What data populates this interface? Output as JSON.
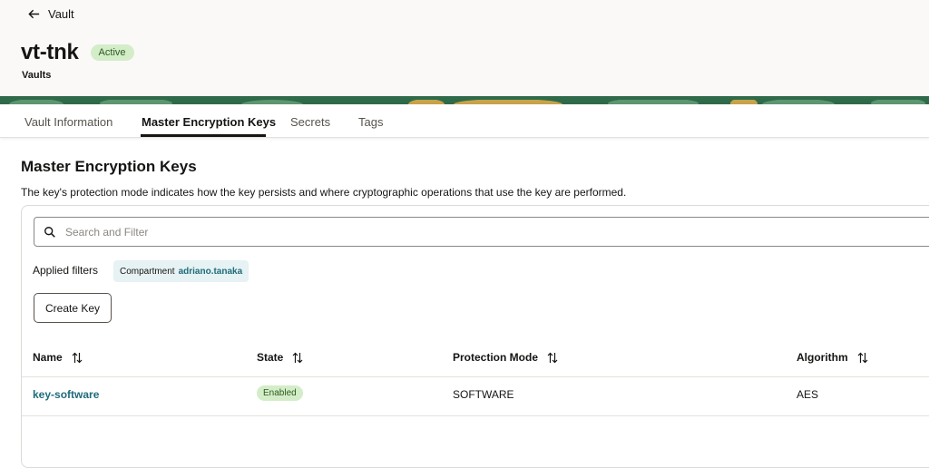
{
  "header": {
    "back_label": "Vault",
    "title": "vt-tnk",
    "status": "Active",
    "subtitle": "Vaults"
  },
  "tabs": [
    {
      "label": "Vault Information"
    },
    {
      "label": "Master Encryption Keys"
    },
    {
      "label": "Secrets"
    },
    {
      "label": "Tags"
    }
  ],
  "section": {
    "title": "Master Encryption Keys",
    "description": "The key's protection mode indicates how the key persists and where cryptographic operations that use the key are performed."
  },
  "search": {
    "placeholder": "Search and Filter",
    "value": ""
  },
  "filters": {
    "label": "Applied filters",
    "chip_key": "Compartment",
    "chip_value": "adriano.tanaka"
  },
  "actions": {
    "create_label": "Create Key"
  },
  "table": {
    "columns": [
      "Name",
      "State",
      "Protection Mode",
      "Algorithm"
    ],
    "rows": [
      {
        "name": "key-software",
        "state": "Enabled",
        "protection_mode": "SOFTWARE",
        "algorithm": "AES"
      }
    ]
  },
  "colors": {
    "accent_link": "#1f6b7a",
    "status_green_bg": "#d4edc9",
    "banner_green": "#2f6b4a"
  }
}
